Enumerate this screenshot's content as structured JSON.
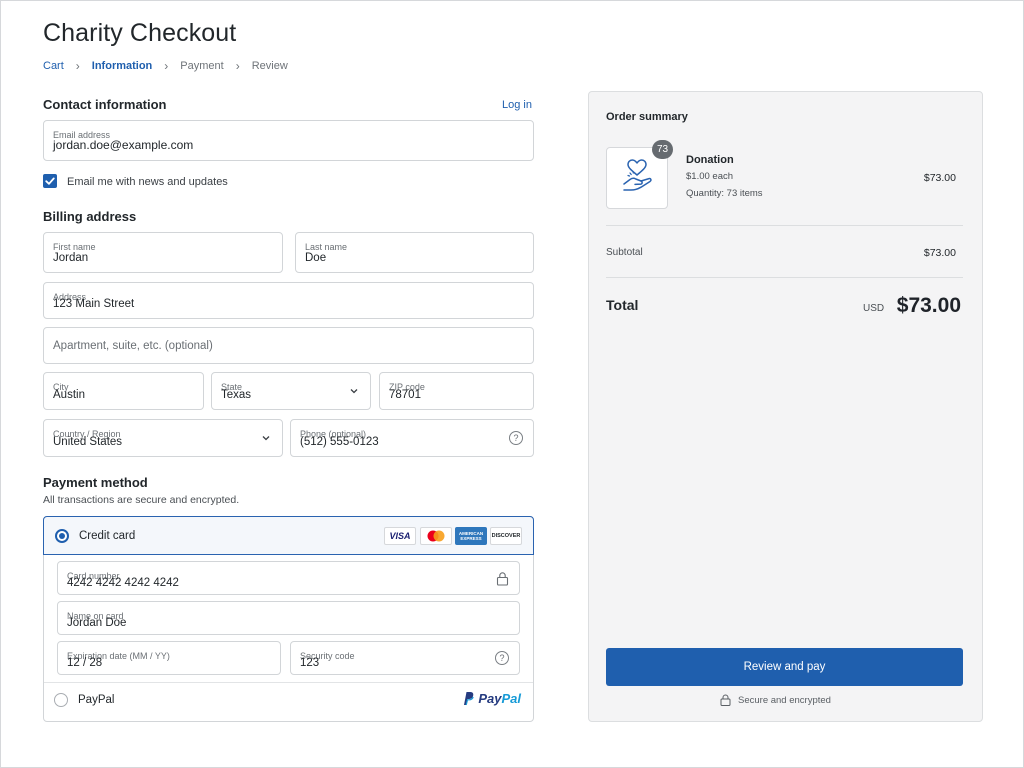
{
  "page": {
    "title": "Charity Checkout",
    "breadcrumb": [
      {
        "label": "Cart",
        "state": "link"
      },
      {
        "label": "Information",
        "state": "active"
      },
      {
        "label": "Payment",
        "state": "inactive"
      },
      {
        "label": "Review",
        "state": "inactive"
      }
    ]
  },
  "contact": {
    "title": "Contact information",
    "login_label": "Log in",
    "email_label": "Email address",
    "email_value": "jordan.doe@example.com",
    "newsletter_label": "Email me with news and updates",
    "newsletter_checked": true
  },
  "billing": {
    "title": "Billing address",
    "first_name_label": "First name",
    "first_name_value": "Jordan",
    "last_name_label": "Last name",
    "last_name_value": "Doe",
    "address_label": "Address",
    "address_value": "123 Main Street",
    "apartment_placeholder": "Apartment, suite, etc. (optional)",
    "city_label": "City",
    "city_value": "Austin",
    "state_label": "State",
    "state_value": "Texas",
    "zip_label": "ZIP code",
    "zip_value": "78701",
    "country_label": "Country / Region",
    "country_value": "United States",
    "phone_label": "Phone (optional)",
    "phone_value": "(512) 555-0123",
    "help_glyph": "?"
  },
  "payment": {
    "title": "Payment method",
    "subtitle": "All transactions are secure and encrypted.",
    "credit_card_label": "Credit card",
    "card_brands": {
      "visa": "VISA",
      "amex_top": "AMERICAN",
      "amex_bottom": "EXPRESS",
      "discover": "DISCOVER"
    },
    "card_number_label": "Card number",
    "card_number_value": "4242 4242 4242 4242",
    "name_on_card_label": "Name on card",
    "name_on_card_value": "Jordan Doe",
    "expiration_label": "Expiration date (MM / YY)",
    "expiration_value": "12 / 28",
    "security_code_label": "Security code",
    "security_code_value": "123",
    "paypal_label": "PayPal",
    "paypal_logo_pay": "Pay",
    "paypal_logo_pal": "Pal",
    "selected": "credit_card"
  },
  "summary": {
    "title": "Order summary",
    "item": {
      "name": "Donation",
      "unit_price": "$1.00 each",
      "quantity_text": "Quantity: 73 items",
      "quantity_badge": "73",
      "price": "$73.00",
      "icon": "hand-heart-icon"
    },
    "subtotal_label": "Subtotal",
    "subtotal_value": "$73.00",
    "total_label": "Total",
    "currency": "USD",
    "total_value": "$73.00",
    "pay_button_label": "Review and pay",
    "secure_note": "Secure and encrypted"
  },
  "colors": {
    "accent": "#1f5fae",
    "border": "#d2d5d8",
    "summary_bg": "#f4f4f5",
    "mastercard_red": "#eb001b",
    "mastercard_orange": "#f79e1b",
    "amex_blue": "#2e77bc",
    "discover_orange": "#f58220",
    "paypal_dark": "#253b80",
    "paypal_light": "#179bd7"
  }
}
